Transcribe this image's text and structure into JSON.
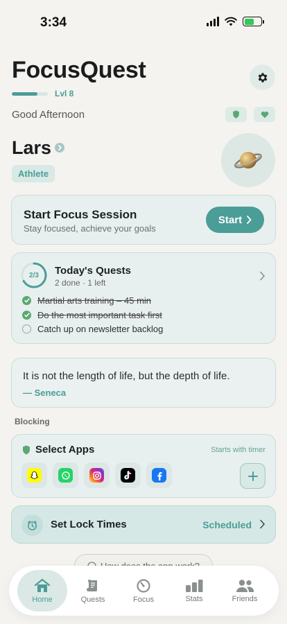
{
  "status_bar": {
    "time": "3:34",
    "battery_fill": 0.6
  },
  "header": {
    "app_title": "FocusQuest",
    "level": "Lvl 8",
    "xp_progress": 0.72
  },
  "greeting": "Good Afternoon",
  "user": {
    "name": "Lars",
    "role": "Athlete"
  },
  "focus_session": {
    "title": "Start Focus Session",
    "subtitle": "Stay focused, achieve your goals",
    "button_label": "Start"
  },
  "quests": {
    "progress_label": "2/3",
    "progress": 0.667,
    "title": "Today's Quests",
    "summary": "2 done · 1 left",
    "items": [
      {
        "label": "Martial arts training – 45 min",
        "done": true
      },
      {
        "label": "Do the most important task first",
        "done": true
      },
      {
        "label": "Catch up on newsletter backlog",
        "done": false
      }
    ]
  },
  "quote": {
    "text": "It is not the length of life, but the depth of life.",
    "author": "— Seneca"
  },
  "blocking": {
    "section_label": "Blocking",
    "title": "Select Apps",
    "note": "Starts with timer",
    "apps": [
      {
        "name": "snapchat-icon",
        "color": "#fffc00"
      },
      {
        "name": "whatsapp-icon",
        "color": "#25d366"
      },
      {
        "name": "instagram-icon",
        "color": "#d62976"
      },
      {
        "name": "tiktok-icon",
        "color": "#000000"
      },
      {
        "name": "facebook-icon",
        "color": "#1877f2"
      }
    ]
  },
  "lock_times": {
    "title": "Set Lock Times",
    "status": "Scheduled"
  },
  "help": {
    "label": "How does the app work?"
  },
  "tabs": [
    {
      "label": "Home",
      "active": true
    },
    {
      "label": "Quests",
      "active": false
    },
    {
      "label": "Focus",
      "active": false
    },
    {
      "label": "Stats",
      "active": false
    },
    {
      "label": "Friends",
      "active": false
    }
  ],
  "colors": {
    "accent": "#4b9d97",
    "background": "#f4f3ef",
    "card": "#e8f0ef",
    "done_check": "#5aa872"
  }
}
